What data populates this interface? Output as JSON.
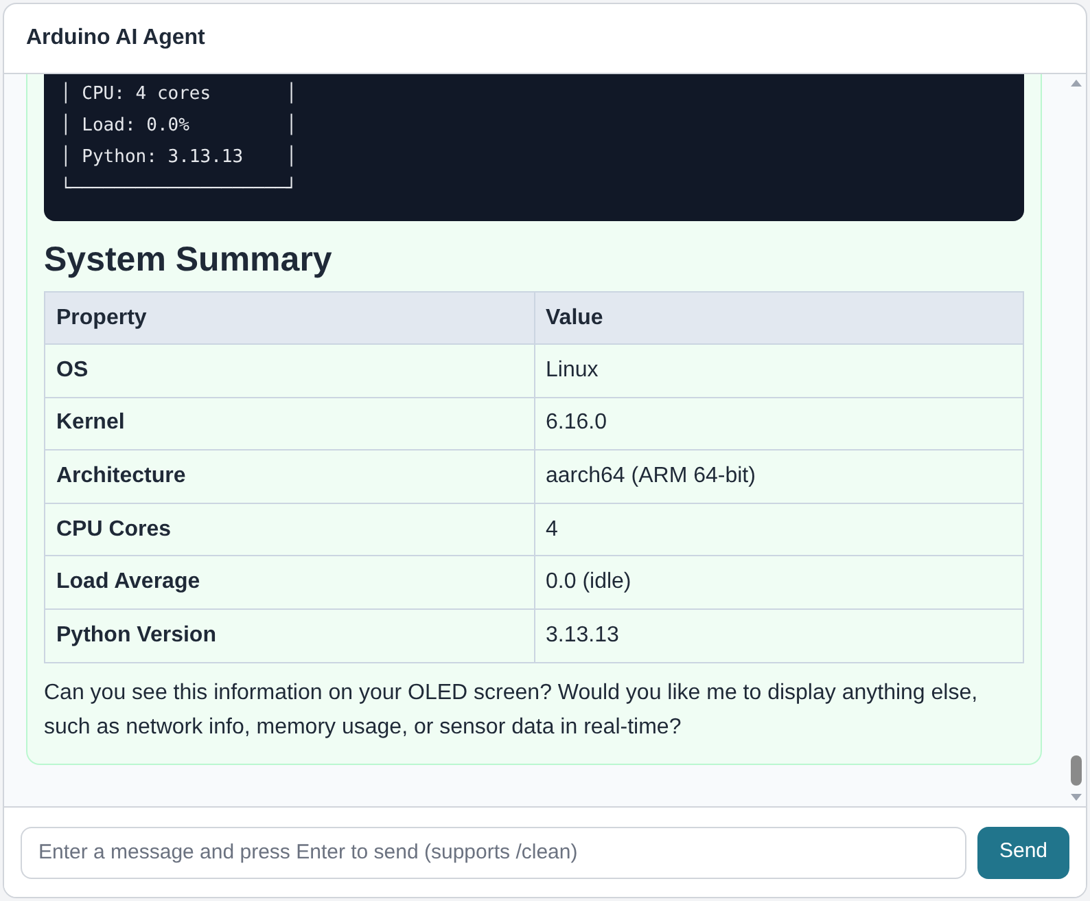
{
  "window": {
    "title": "Arduino AI Agent"
  },
  "message": {
    "code_lines": [
      "│ CPU: 4 cores       │",
      "│ Load: 0.0%         │",
      "│ Python: 3.13.13    │",
      "└────────────────────┘"
    ],
    "heading": "System Summary",
    "table": {
      "columns": [
        "Property",
        "Value"
      ],
      "rows": [
        [
          "OS",
          "Linux"
        ],
        [
          "Kernel",
          "6.16.0"
        ],
        [
          "Architecture",
          "aarch64 (ARM 64-bit)"
        ],
        [
          "CPU Cores",
          "4"
        ],
        [
          "Load Average",
          "0.0 (idle)"
        ],
        [
          "Python Version",
          "3.13.13"
        ]
      ]
    },
    "text": "Can you see this information on your OLED screen? Would you like me to display anything else, such as network info, memory usage, or sensor data in real-time?"
  },
  "composer": {
    "placeholder": "Enter a message and press Enter to send (supports /clean)",
    "send": "Send"
  }
}
